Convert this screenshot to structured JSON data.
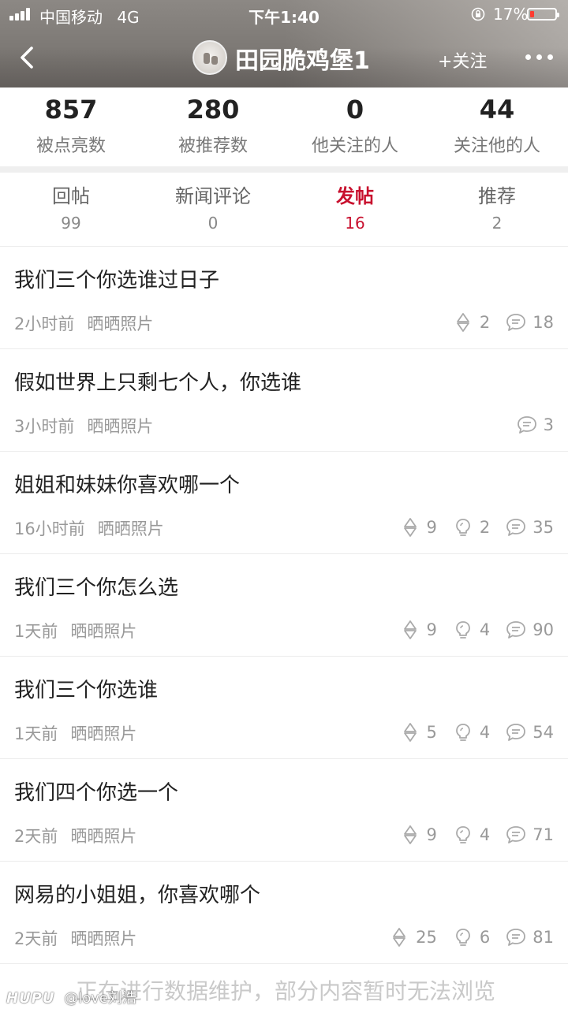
{
  "status_bar": {
    "carrier": "中国移动",
    "network": "4G",
    "time": "下午1:40",
    "battery_pct": "17%",
    "battery_level": 0.17
  },
  "header": {
    "username": "田园脆鸡堡1",
    "follow_label": "+关注",
    "back_icon": "chevron-left-icon",
    "more_icon": "more-dots-icon"
  },
  "stats": [
    {
      "value": "857",
      "label": "被点亮数"
    },
    {
      "value": "280",
      "label": "被推荐数"
    },
    {
      "value": "0",
      "label": "他关注的人"
    },
    {
      "value": "44",
      "label": "关注他的人"
    }
  ],
  "tabs": [
    {
      "label": "回帖",
      "count": "99",
      "active": false
    },
    {
      "label": "新闻评论",
      "count": "0",
      "active": false
    },
    {
      "label": "发帖",
      "count": "16",
      "active": true
    },
    {
      "label": "推荐",
      "count": "2",
      "active": false
    }
  ],
  "posts": [
    {
      "title": "我们三个你选谁过日子",
      "time": "2小时前",
      "board": "晒晒照片",
      "votes": "2",
      "lights": "",
      "comments": "18"
    },
    {
      "title": "假如世界上只剩七个人，你选谁",
      "time": "3小时前",
      "board": "晒晒照片",
      "votes": "",
      "lights": "",
      "comments": "3"
    },
    {
      "title": "姐姐和妹妹你喜欢哪一个",
      "time": "16小时前",
      "board": "晒晒照片",
      "votes": "9",
      "lights": "2",
      "comments": "35"
    },
    {
      "title": "我们三个你怎么选",
      "time": "1天前",
      "board": "晒晒照片",
      "votes": "9",
      "lights": "4",
      "comments": "90"
    },
    {
      "title": "我们三个你选谁",
      "time": "1天前",
      "board": "晒晒照片",
      "votes": "5",
      "lights": "4",
      "comments": "54"
    },
    {
      "title": "我们四个你选一个",
      "time": "2天前",
      "board": "晒晒照片",
      "votes": "9",
      "lights": "4",
      "comments": "71"
    },
    {
      "title": "网易的小姐姐，你喜欢哪个",
      "time": "2天前",
      "board": "晒晒照片",
      "votes": "25",
      "lights": "6",
      "comments": "81"
    }
  ],
  "footer": {
    "notice": "正在进行数据维护，部分内容暂时无法浏览",
    "watermark_logo": "HUPU",
    "watermark_user": "@love刘浩"
  },
  "colors": {
    "accent": "#c8102e",
    "text_primary": "#222222",
    "text_secondary": "#999999",
    "separator": "#efefef",
    "battery_low": "#ff3b30"
  }
}
